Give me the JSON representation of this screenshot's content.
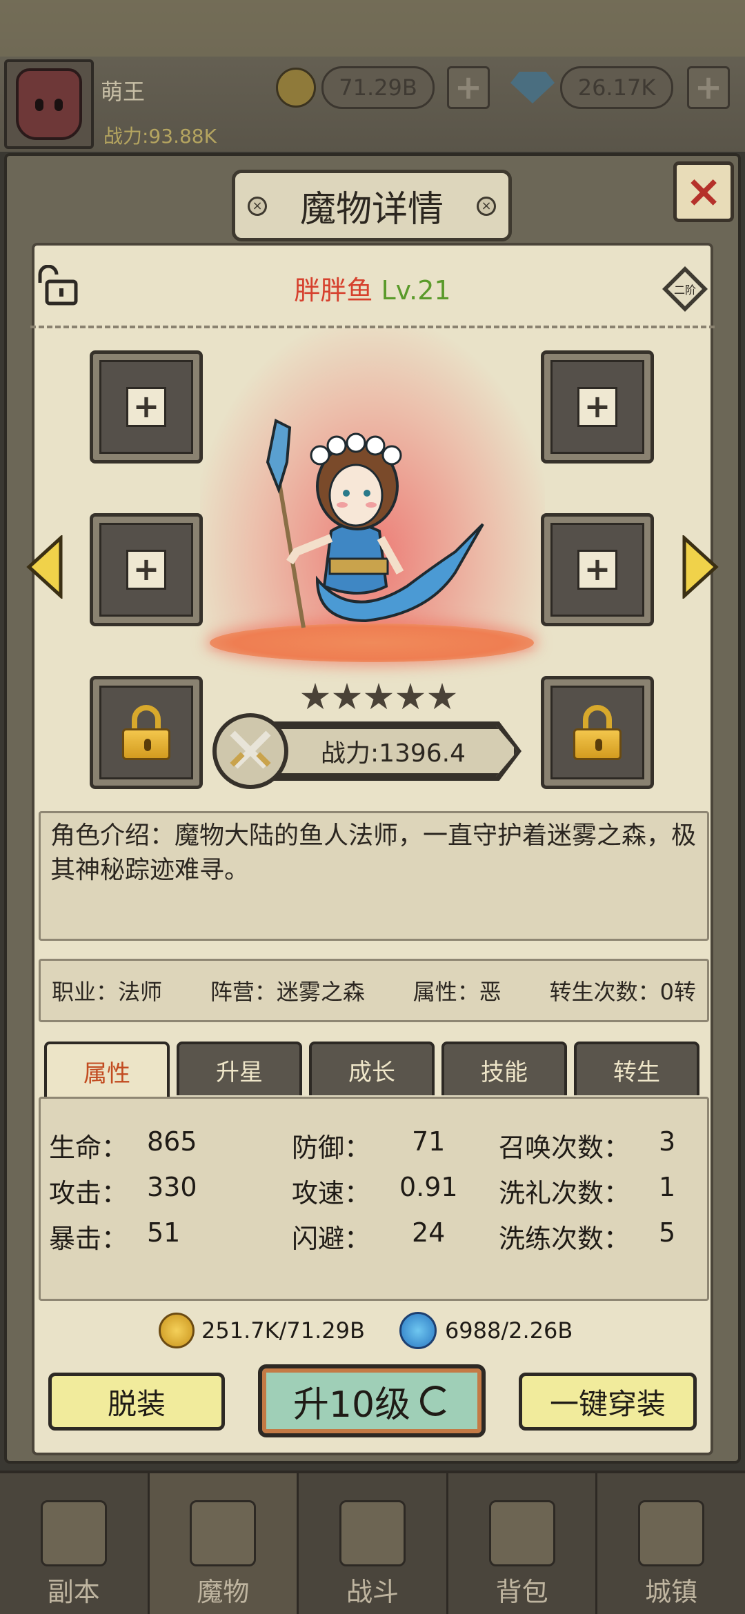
{
  "player": {
    "name": "萌王",
    "power": "战力:93.88K",
    "gold": "71.29B",
    "gems": "26.17K"
  },
  "dialog": {
    "title": "魔物详情",
    "close_label": "×"
  },
  "character": {
    "name": "胖胖鱼",
    "level": "Lv.21",
    "tier": "二阶",
    "stars": 5,
    "power": "战力:1396.4",
    "description": "角色介绍：魔物大陆的鱼人法师，一直守护着迷雾之森，极其神秘踪迹难寻。"
  },
  "info": {
    "job": "职业：法师",
    "faction": "阵营：迷雾之森",
    "attribute": "属性：恶",
    "rebirth": "转生次数：0转"
  },
  "tabs": [
    "属性",
    "升星",
    "成长",
    "技能",
    "转生"
  ],
  "active_tab": 0,
  "stats": {
    "hp_label": "生命：",
    "hp": "865",
    "atk_label": "攻击：",
    "atk": "330",
    "crit_label": "暴击：",
    "crit": "51",
    "def_label": "防御：",
    "def": "71",
    "spd_label": "攻速：",
    "spd": "0.91",
    "dodge_label": "闪避：",
    "dodge": "24",
    "summon_label": "召唤次数：",
    "summon": "3",
    "baptism_label": "洗礼次数：",
    "baptism": "1",
    "refine_label": "洗练次数：",
    "refine": "5"
  },
  "cost": {
    "gold": "251.7K/71.29B",
    "soul": "6988/2.26B"
  },
  "buttons": {
    "unequip": "脱装",
    "upgrade": "升10级",
    "equip_all": "一键穿装"
  },
  "nav": [
    "副本",
    "魔物",
    "战斗",
    "背包",
    "城镇"
  ],
  "nav_active": 1,
  "colors": {
    "name_red": "#d6412e",
    "level_green": "#5a9a2a",
    "tab_active_text": "#c24b20",
    "upgrade_button": "#9fcfb7",
    "side_button": "#f1eb9c"
  }
}
